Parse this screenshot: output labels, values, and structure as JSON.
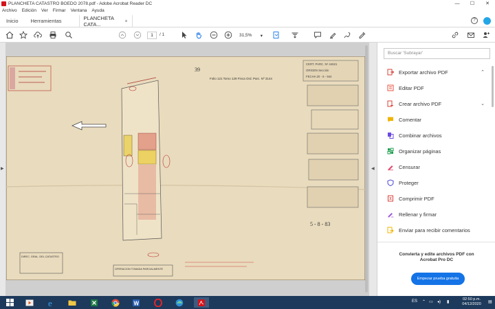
{
  "window": {
    "title": "PLANCHETA CATASTRO BOEDO 2078.pdf - Adobe Acrobat Reader DC",
    "minimize": "—",
    "maximize": "☐",
    "close": "✕"
  },
  "menu": [
    "Archivo",
    "Edición",
    "Ver",
    "Firmar",
    "Ventana",
    "Ayuda"
  ],
  "tabs": {
    "home": "Inicio",
    "tools": "Herramientas",
    "doc": "PLANCHETA CATA...",
    "doc_close": "×"
  },
  "toolbar": {
    "page_current": "1",
    "page_total": "/  1",
    "zoom": "31,5%",
    "zoom_caret": "▾"
  },
  "document": {
    "number": "39",
    "stamp_left_label": "DIREC. GRAL. DEL CATASTRO",
    "stamp_bottom": "OPERACION TOMADA PARCIALMENTE",
    "cert_lines": [
      {
        "label": "CERT. PARC. Nº",
        "value": "44621"
      },
      {
        "label": "ORIGEN",
        "value": "Sección"
      },
      {
        "label": "FECHA",
        "value": "20 - 6 - 944"
      }
    ],
    "date_bottom_right": "5 - 8 - 83",
    "header_line": "Folio 121 Tomo 129 Finca Ord. Parc. Nº 3144"
  },
  "panel": {
    "search_placeholder": "Buscar 'Subrayar'",
    "tools": [
      {
        "label": "Exportar archivo PDF",
        "icon": "export-pdf-icon",
        "color": "#d9413a",
        "chevron": "⌃"
      },
      {
        "label": "Editar PDF",
        "icon": "edit-pdf-icon",
        "color": "#e8503c",
        "chevron": ""
      },
      {
        "label": "Crear archivo PDF",
        "icon": "create-pdf-icon",
        "color": "#d9413a",
        "chevron": "⌄"
      },
      {
        "label": "Comentar",
        "icon": "comment-icon",
        "color": "#f0b400",
        "chevron": ""
      },
      {
        "label": "Combinar archivos",
        "icon": "combine-files-icon",
        "color": "#6b4be0",
        "chevron": ""
      },
      {
        "label": "Organizar páginas",
        "icon": "organize-pages-icon",
        "color": "#1f9e4f",
        "chevron": ""
      },
      {
        "label": "Censurar",
        "icon": "redact-icon",
        "color": "#e34a6f",
        "chevron": ""
      },
      {
        "label": "Proteger",
        "icon": "protect-icon",
        "color": "#5a55d6",
        "chevron": ""
      },
      {
        "label": "Comprimir PDF",
        "icon": "compress-pdf-icon",
        "color": "#d9413a",
        "chevron": ""
      },
      {
        "label": "Rellenar y firmar",
        "icon": "fill-sign-icon",
        "color": "#a05fd8",
        "chevron": ""
      },
      {
        "label": "Enviar para recibir comentarios",
        "icon": "send-comments-icon",
        "color": "#f0b400",
        "chevron": ""
      }
    ],
    "promo_text": "Convierta y edite archivos PDF con Acrobat Pro DC",
    "promo_button": "Empezar prueba gratuita"
  },
  "taskbar": {
    "lang": "ES",
    "time": "02:50 p.m.",
    "date": "04/12/2020"
  }
}
